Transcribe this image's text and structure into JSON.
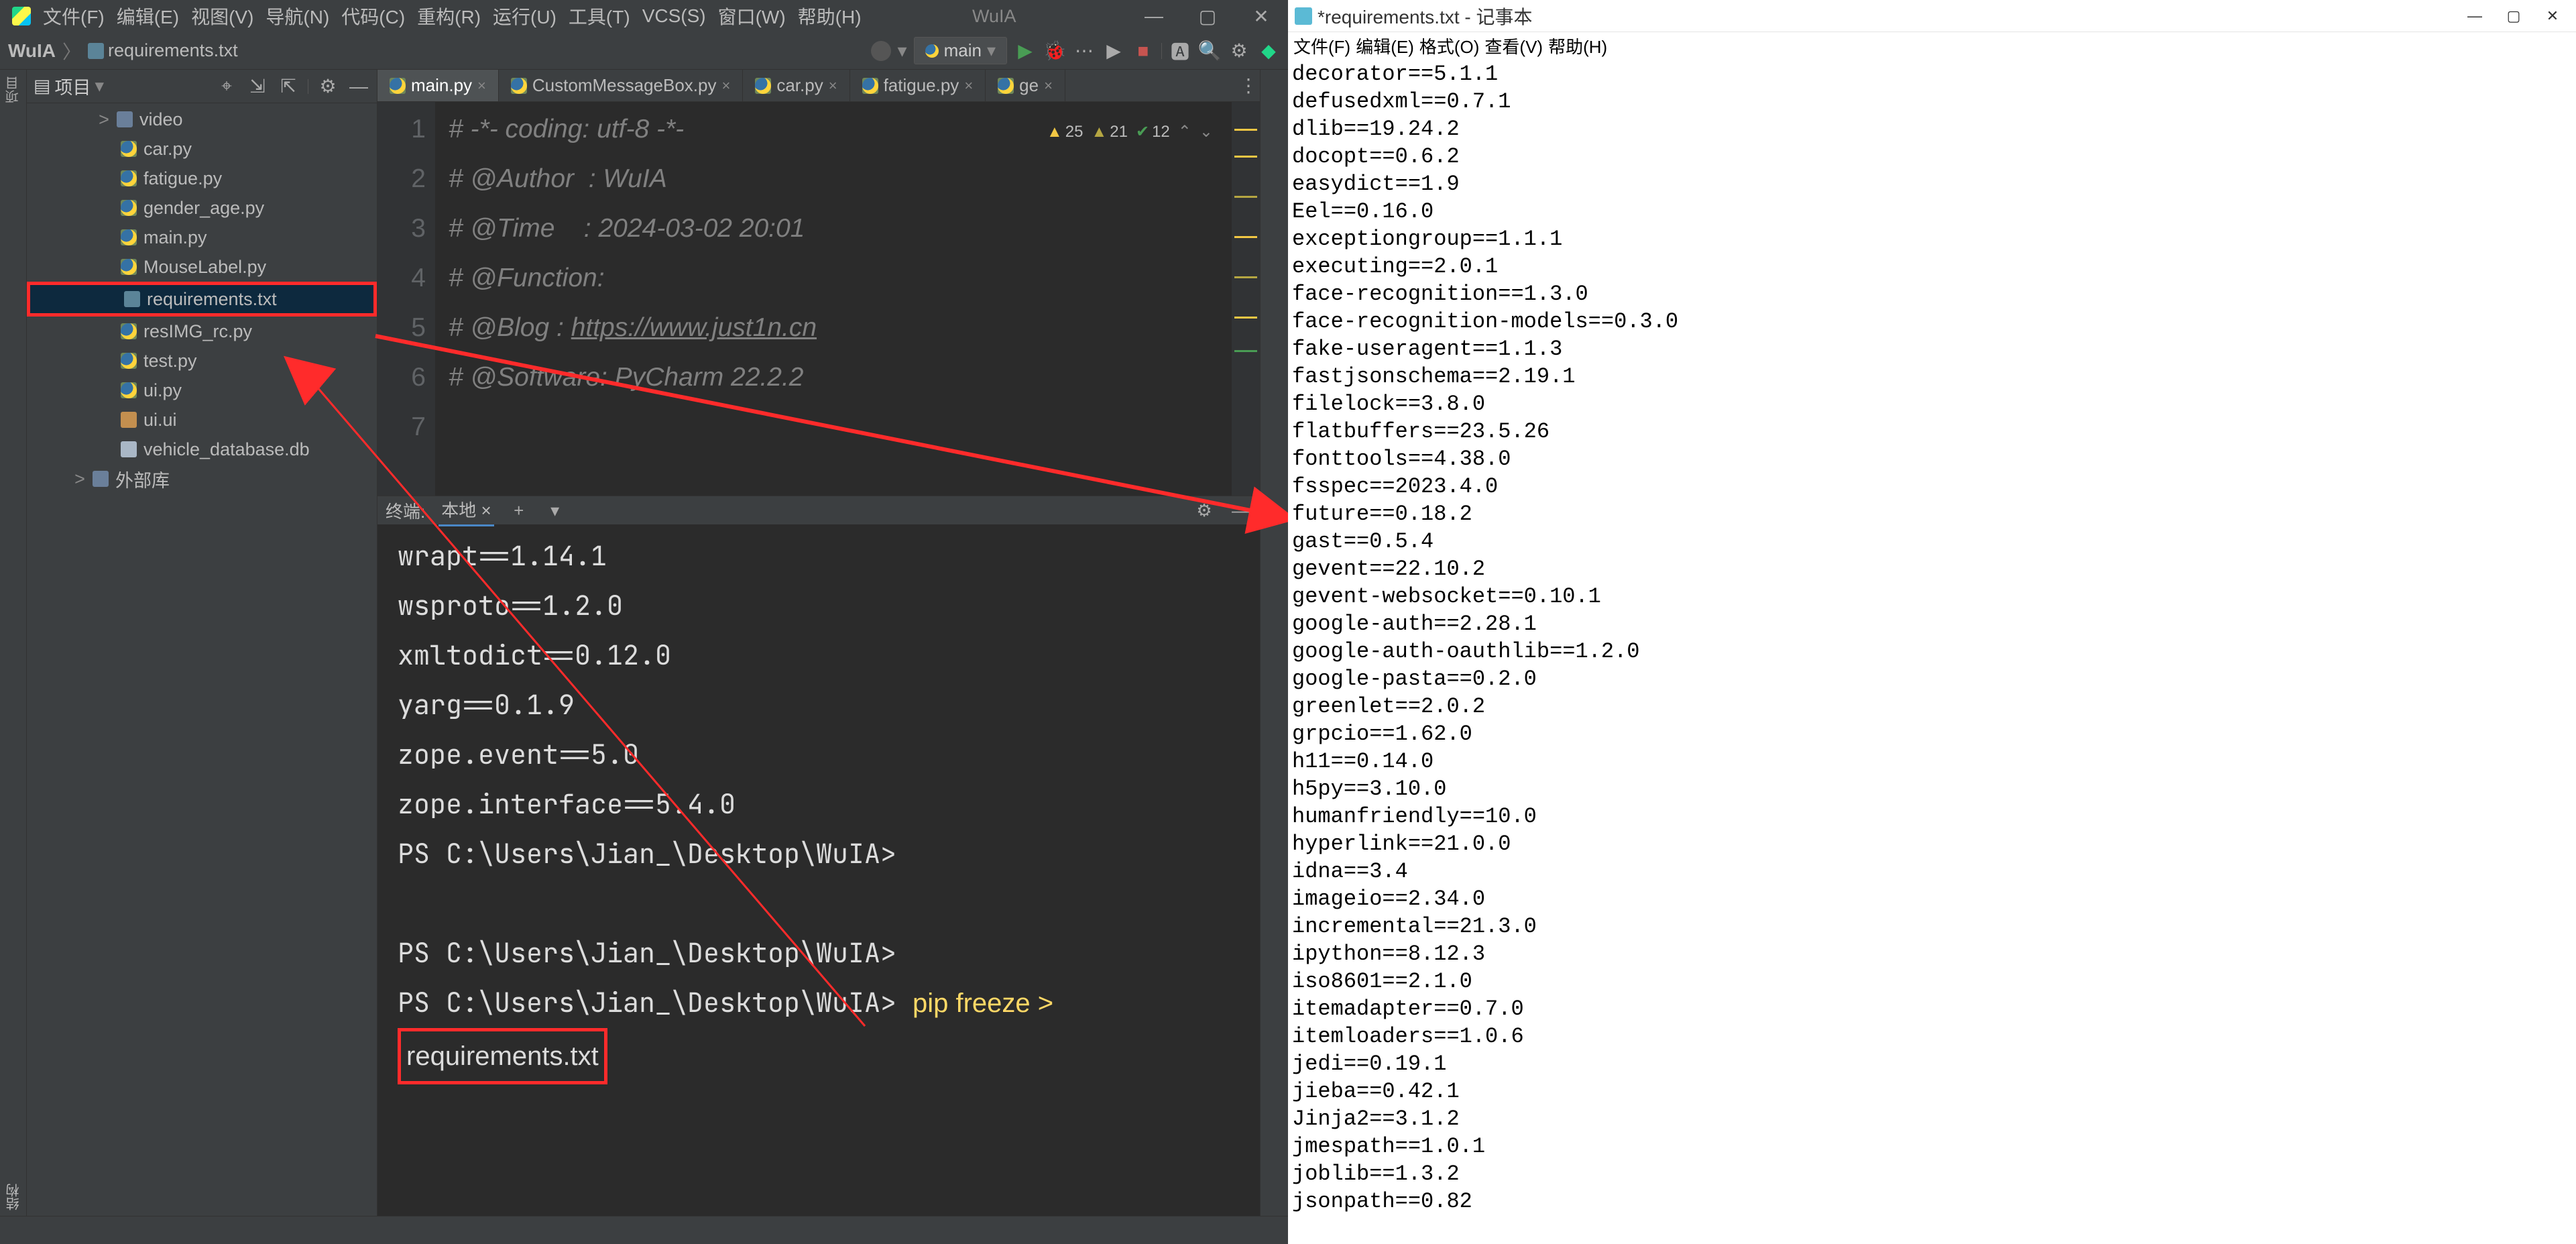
{
  "pycharm": {
    "menu": [
      "文件(F)",
      "编辑(E)",
      "视图(V)",
      "导航(N)",
      "代码(C)",
      "重构(R)",
      "运行(U)",
      "工具(T)",
      "VCS(S)",
      "窗口(W)",
      "帮助(H)"
    ],
    "window_title": "WuIA",
    "breadcrumb_project": "WuIA",
    "breadcrumb_file": "requirements.txt",
    "run_config": "main",
    "project_panel_title": "项目",
    "tree": [
      {
        "kind": "folder",
        "label": "video",
        "chev": ">"
      },
      {
        "kind": "py",
        "label": "car.py"
      },
      {
        "kind": "py",
        "label": "fatigue.py"
      },
      {
        "kind": "py",
        "label": "gender_age.py"
      },
      {
        "kind": "py",
        "label": "main.py"
      },
      {
        "kind": "py",
        "label": "MouseLabel.py"
      },
      {
        "kind": "txt",
        "label": "requirements.txt",
        "selected": true
      },
      {
        "kind": "py",
        "label": "resIMG_rc.py"
      },
      {
        "kind": "py",
        "label": "test.py"
      },
      {
        "kind": "py",
        "label": "ui.py"
      },
      {
        "kind": "ui",
        "label": "ui.ui"
      },
      {
        "kind": "db",
        "label": "vehicle_database.db"
      },
      {
        "kind": "lib",
        "label": "外部库",
        "chev": ">"
      }
    ],
    "editor_tabs": [
      {
        "label": "main.py",
        "active": true
      },
      {
        "label": "CustomMessageBox.py"
      },
      {
        "label": "car.py"
      },
      {
        "label": "fatigue.py"
      },
      {
        "label": "ge"
      }
    ],
    "inspections": {
      "err": "25",
      "warn": "21",
      "ok": "12"
    },
    "code_lines": [
      "# -*- coding: utf-8 -*-",
      "# @Author  : WuIA",
      "# @Time    : 2024-03-02 20:01",
      "# @Function:",
      "# @Blog    : https://www.just1n.cn",
      "# @Software: PyCharm 22.2.2",
      ""
    ],
    "terminal": {
      "title": "终端:",
      "tab": "本地",
      "lines": [
        "wrapt==1.14.1",
        "wsproto==1.2.0",
        "xmltodict==0.12.0",
        "yarg==0.1.9",
        "zope.event==5.0",
        "zope.interface==5.4.0"
      ],
      "prompt": "PS C:\\Users\\Jian_\\Desktop\\WuIA>",
      "cmd_pre": "pip freeze >",
      "cmd_hl": "requirements.txt"
    },
    "bottom_tab": "结构"
  },
  "notepad": {
    "title": "*requirements.txt - 记事本",
    "menu": [
      "文件(F)",
      "编辑(E)",
      "格式(O)",
      "查看(V)",
      "帮助(H)"
    ],
    "lines": [
      "decorator==5.1.1",
      "defusedxml==0.7.1",
      "dlib==19.24.2",
      "docopt==0.6.2",
      "easydict==1.9",
      "Eel==0.16.0",
      "exceptiongroup==1.1.1",
      "executing==2.0.1",
      "face-recognition==1.3.0",
      "face-recognition-models==0.3.0",
      "fake-useragent==1.1.3",
      "fastjsonschema==2.19.1",
      "filelock==3.8.0",
      "flatbuffers==23.5.26",
      "fonttools==4.38.0",
      "fsspec==2023.4.0",
      "future==0.18.2",
      "gast==0.5.4",
      "gevent==22.10.2",
      "gevent-websocket==0.10.1",
      "google-auth==2.28.1",
      "google-auth-oauthlib==1.2.0",
      "google-pasta==0.2.0",
      "greenlet==2.0.2",
      "grpcio==1.62.0",
      "h11==0.14.0",
      "h5py==3.10.0",
      "humanfriendly==10.0",
      "hyperlink==21.0.0",
      "idna==3.4",
      "imageio==2.34.0",
      "incremental==21.3.0",
      "ipython==8.12.3",
      "iso8601==2.1.0",
      "itemadapter==0.7.0",
      "itemloaders==1.0.6",
      "jedi==0.19.1",
      "jieba==0.42.1",
      "Jinja2==3.1.2",
      "jmespath==1.0.1",
      "joblib==1.3.2",
      "jsonpath==0.82"
    ]
  }
}
